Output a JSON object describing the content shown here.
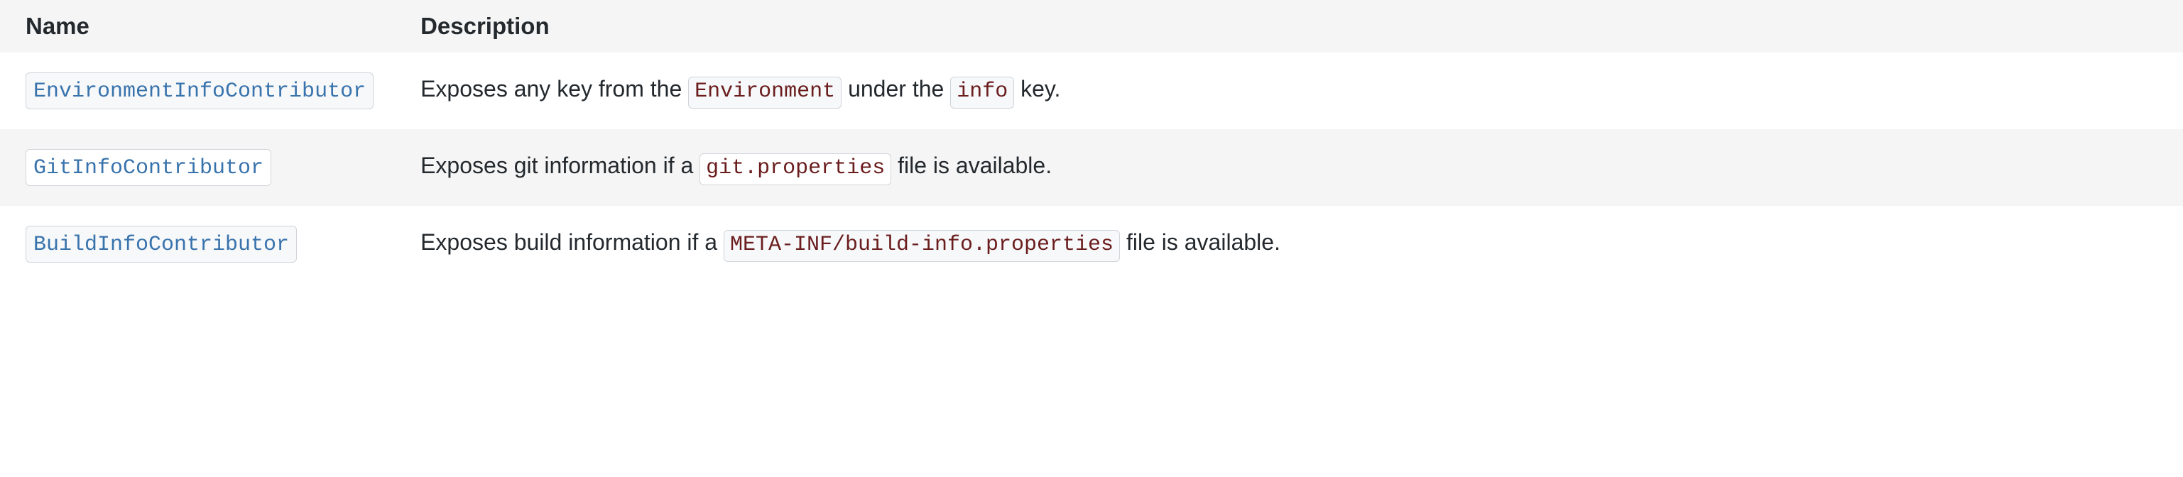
{
  "table": {
    "headers": {
      "name": "Name",
      "description": "Description"
    },
    "rows": [
      {
        "name": "EnvironmentInfoContributor",
        "desc_pre": "Exposes any key from the ",
        "code1": "Environment",
        "desc_mid": " under the ",
        "code2": "info",
        "desc_post": " key."
      },
      {
        "name": "GitInfoContributor",
        "desc_pre": "Exposes git information if a ",
        "code1": "git.properties",
        "desc_mid": "",
        "code2": "",
        "desc_post": " file is available."
      },
      {
        "name": "BuildInfoContributor",
        "desc_pre": "Exposes build information if a ",
        "code1": "META-INF/build-info.properties",
        "desc_mid": "",
        "code2": "",
        "desc_post": " file is available."
      }
    ]
  }
}
